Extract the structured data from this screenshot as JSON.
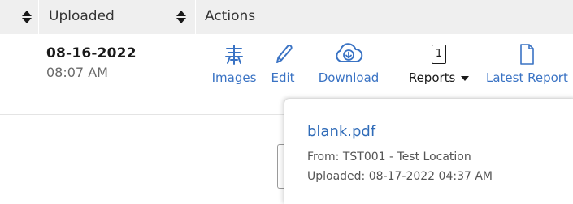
{
  "table": {
    "columns": [
      {
        "label": "Uploaded",
        "sortable": true
      },
      {
        "label": "Actions",
        "sortable": false
      }
    ],
    "row": {
      "date": "08-16-2022",
      "time": "08:07 AM",
      "actions": {
        "images": {
          "label": "Images",
          "icon": "images-icon"
        },
        "edit": {
          "label": "Edit",
          "icon": "pencil-icon"
        },
        "download": {
          "label": "Download",
          "icon": "cloud-download-icon"
        },
        "reports": {
          "label": "Reports",
          "count": "1",
          "icon": "caret-down-icon"
        },
        "latest_report": {
          "label": "Latest Report",
          "icon": "document-icon"
        }
      }
    }
  },
  "popup": {
    "file_name": "blank.pdf",
    "from": "From: TST001 - Test Location",
    "uploaded": "Uploaded: 08-17-2022 04:37 AM"
  },
  "colors": {
    "accent": "#3a73c4",
    "header_bg": "#efefef"
  }
}
